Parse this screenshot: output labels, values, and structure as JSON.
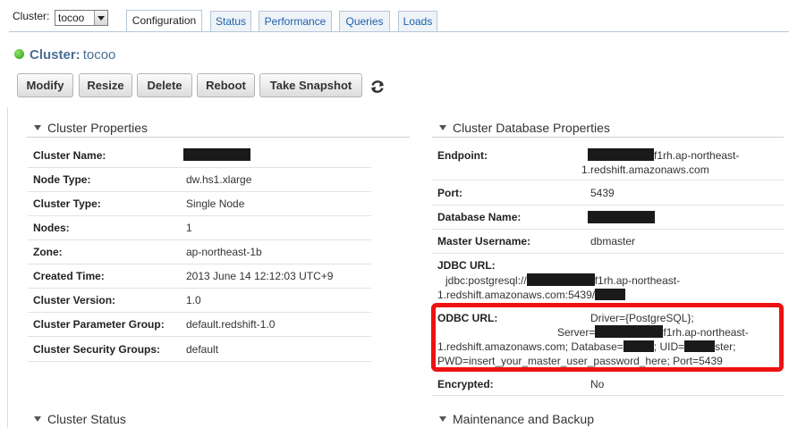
{
  "topbar": {
    "cluster_label": "Cluster:",
    "cluster_select_value": "tocoo"
  },
  "tabs": [
    {
      "label": "Configuration",
      "active": true
    },
    {
      "label": "Status",
      "active": false
    },
    {
      "label": "Performance",
      "active": false
    },
    {
      "label": "Queries",
      "active": false
    },
    {
      "label": "Loads",
      "active": false
    }
  ],
  "header": {
    "title_prefix": "Cluster:",
    "cluster_name": "tocoo",
    "status_color": "#2b9a12"
  },
  "buttons": {
    "modify": "Modify",
    "resize": "Resize",
    "delete": "Delete",
    "reboot": "Reboot",
    "snapshot": "Take Snapshot",
    "refresh_icon": "refresh-icon"
  },
  "cluster_properties": {
    "title": "Cluster Properties",
    "rows": [
      {
        "key": "Cluster Name:",
        "value": ""
      },
      {
        "key": "Node Type:",
        "value": "dw.hs1.xlarge"
      },
      {
        "key": "Cluster Type:",
        "value": "Single Node"
      },
      {
        "key": "Nodes:",
        "value": "1"
      },
      {
        "key": "Zone:",
        "value": "ap-northeast-1b"
      },
      {
        "key": "Created Time:",
        "value": "2013 June 14 12:12:03 UTC+9"
      },
      {
        "key": "Cluster Version:",
        "value": "1.0"
      },
      {
        "key": "Cluster Parameter Group:",
        "value": "default.redshift-1.0"
      },
      {
        "key": "Cluster Security Groups:",
        "value": "default"
      }
    ]
  },
  "database_properties": {
    "title": "Cluster Database Properties",
    "endpoint_label": "Endpoint:",
    "endpoint_value_part1": "f1rh.ap-northeast-",
    "endpoint_value_part2": "1.redshift.amazonaws.com",
    "port_label": "Port:",
    "port_value": "5439",
    "dbname_label": "Database Name:",
    "master_label": "Master Username:",
    "master_value": "dbmaster",
    "jdbc_label": "JDBC URL:",
    "jdbc_part1": "jdbc:postgresql://",
    "jdbc_part2": "f1rh.ap-northeast-",
    "jdbc_part3": "1.redshift.amazonaws.com:5439/",
    "odbc_label": "ODBC URL:",
    "odbc_driver": "Driver={PostgreSQL};",
    "odbc_server": "Server=",
    "odbc_server_tail": "f1rh.ap-northeast-",
    "odbc_line3_a": "1.redshift.amazonaws.com; Database=",
    "odbc_line3_b": "; UID=",
    "odbc_line3_c": "ster;",
    "odbc_line4": "PWD=insert_your_master_user_password_here; Port=5439",
    "encrypted_label": "Encrypted:",
    "encrypted_value": "No",
    "highlight_color": "#ee1111"
  },
  "lower_sections": {
    "status_title": "Cluster Status",
    "maintenance_title": "Maintenance and Backup"
  }
}
